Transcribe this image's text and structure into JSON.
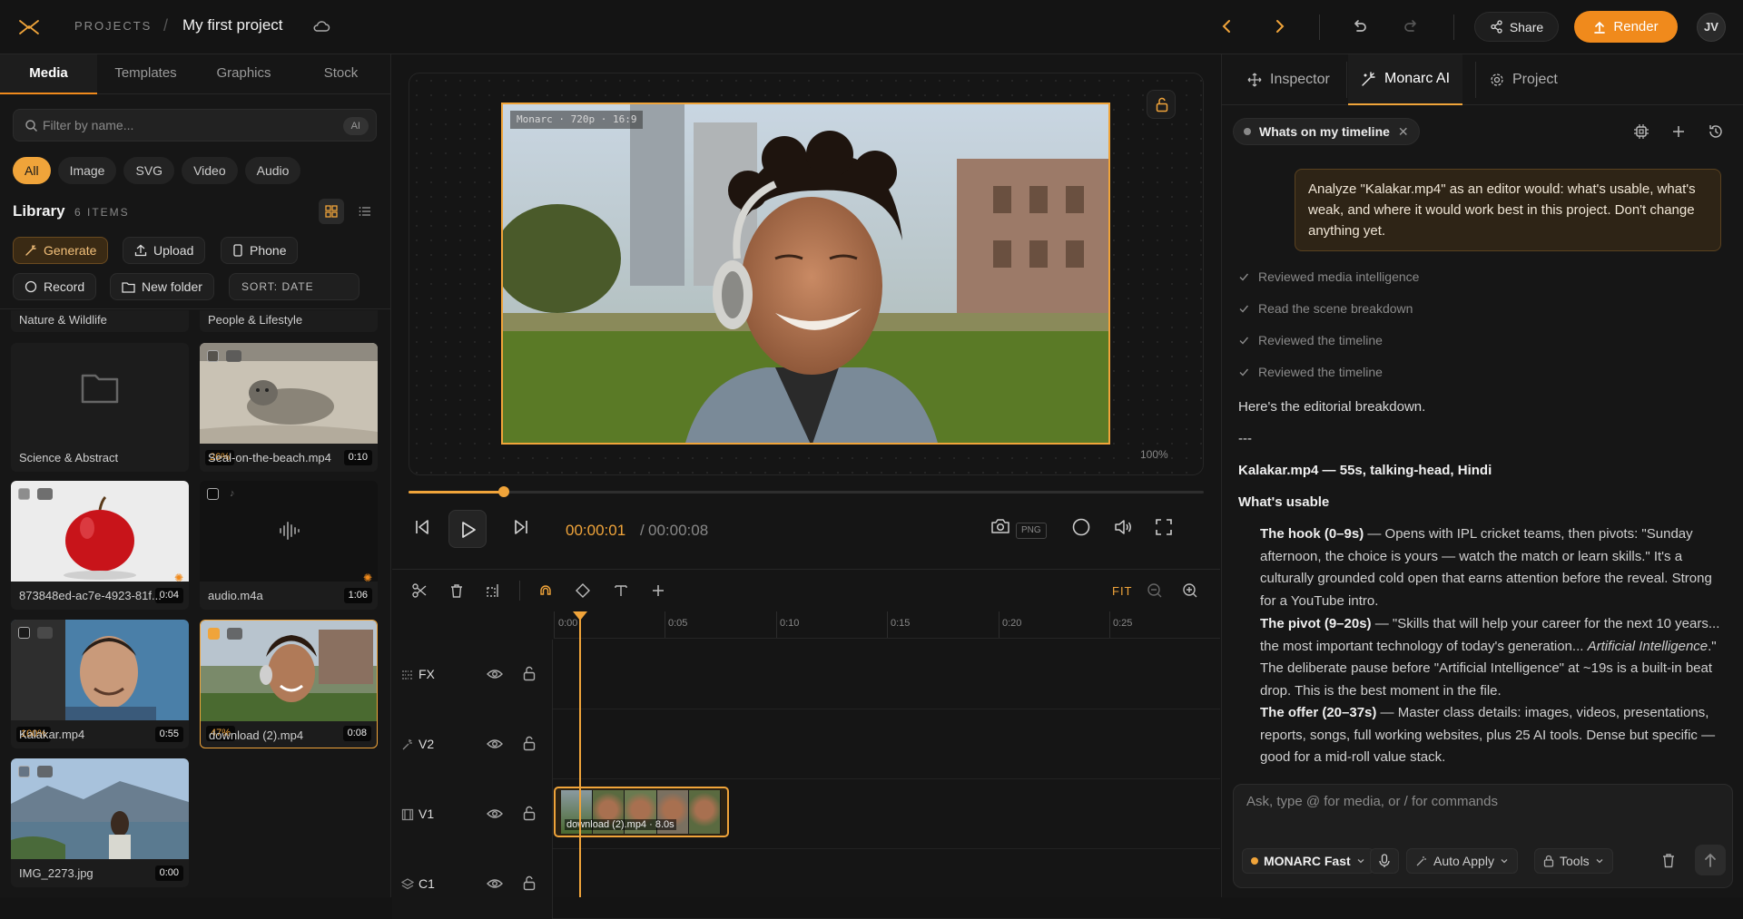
{
  "header": {
    "projects_label": "PROJECTS",
    "separator": "/",
    "project_title": "My first project",
    "share_label": "Share",
    "render_label": "Render",
    "avatar_initials": "JV"
  },
  "left_panel": {
    "tabs": [
      {
        "label": "Media",
        "active": true
      },
      {
        "label": "Templates",
        "active": false
      },
      {
        "label": "Graphics",
        "active": false
      },
      {
        "label": "Stock",
        "active": false
      }
    ],
    "search_placeholder": "Filter by name...",
    "search_badge": "AI",
    "filters": [
      {
        "label": "All",
        "active": true
      },
      {
        "label": "Image",
        "active": false
      },
      {
        "label": "SVG",
        "active": false
      },
      {
        "label": "Video",
        "active": false
      },
      {
        "label": "Audio",
        "active": false
      }
    ],
    "library_title": "Library",
    "library_count": "6 ITEMS",
    "actions": {
      "generate": "Generate",
      "upload": "Upload",
      "phone": "Phone",
      "record": "Record",
      "new_folder": "New folder",
      "sort": "SORT: DATE"
    },
    "folder_labels_top": [
      "Nature & Wildlife",
      "People & Lifestyle"
    ],
    "items": [
      {
        "name": "Science & Abstract",
        "type": "folder"
      },
      {
        "name": "Seal-on-the-beach.mp4",
        "duration": "0:10",
        "progress": "26%"
      },
      {
        "name": "873848ed-ac7e-4923-81f...",
        "duration": "0:04"
      },
      {
        "name": "audio.m4a",
        "duration": "1:06"
      },
      {
        "name": "Kalakar.mp4",
        "duration": "0:55",
        "progress": "100%"
      },
      {
        "name": "download (2).mp4",
        "duration": "0:08",
        "progress": "47%",
        "selected": true
      },
      {
        "name": "IMG_2273.jpg",
        "duration": "0:00"
      }
    ]
  },
  "preview": {
    "watermark": "Monarc · 720p · 16:9",
    "zoom": "100%",
    "progress_fraction": 0.12,
    "time_current": "00:00:01",
    "time_separator": "/",
    "time_total": "00:00:08",
    "png_label": "PNG"
  },
  "timeline": {
    "fit_label": "FIT",
    "ruler_labels": [
      "0:00",
      "0:05",
      "0:10",
      "0:15",
      "0:20",
      "0:25"
    ],
    "tracks": [
      {
        "name": "FX"
      },
      {
        "name": "V2"
      },
      {
        "name": "V1"
      },
      {
        "name": "C1"
      }
    ],
    "clip_label": "download (2).mp4 · 8.0s"
  },
  "right_panel": {
    "tabs": [
      {
        "label": "Inspector",
        "active": false
      },
      {
        "label": "Monarc AI",
        "active": true
      },
      {
        "label": "Project",
        "active": false
      }
    ],
    "chat_title": "Whats on my timeline",
    "user_message": "Analyze \"Kalakar.mp4\" as an editor would: what's usable, what's weak, and where it would work best in this project. Don't change anything yet.",
    "steps": [
      "Reviewed media intelligence",
      "Read the scene breakdown",
      "Reviewed the timeline",
      "Reviewed the timeline"
    ],
    "intro": "Here's the editorial breakdown.",
    "rule": "---",
    "heading": "Kalakar.mp4 — 55s, talking-head, Hindi",
    "subheading": "What's usable",
    "points": [
      {
        "title": "The hook (0–9s)",
        "text": " — Opens with IPL cricket teams, then pivots: \"Sunday afternoon, the choice is yours — watch the match or learn skills.\" It's a culturally grounded cold open that earns attention before the reveal. Strong for a YouTube intro."
      },
      {
        "title": "The pivot (9–20s)",
        "text_before": " — \"Skills that will help your career for the next 10 years... the most important technology of today's generation... ",
        "emphasis": "Artificial Intelligence",
        "text_after": ".\" The deliberate pause before \"Artificial Intelligence\" at ~19s is a built-in beat drop. This is the best moment in the file."
      },
      {
        "title": "The offer (20–37s)",
        "text": " — Master class details: images, videos, presentations, reports, songs, full working websites, plus 25 AI tools. Dense but specific — good for a mid-roll value stack."
      }
    ],
    "composer_placeholder": "Ask, type @ for media, or / for commands",
    "model_label": "MONARC Fast",
    "auto_apply_label": "Auto Apply",
    "tools_label": "Tools"
  },
  "colors": {
    "accent": "#f0a43a",
    "render": "#f08a1c",
    "background": "#141414"
  }
}
